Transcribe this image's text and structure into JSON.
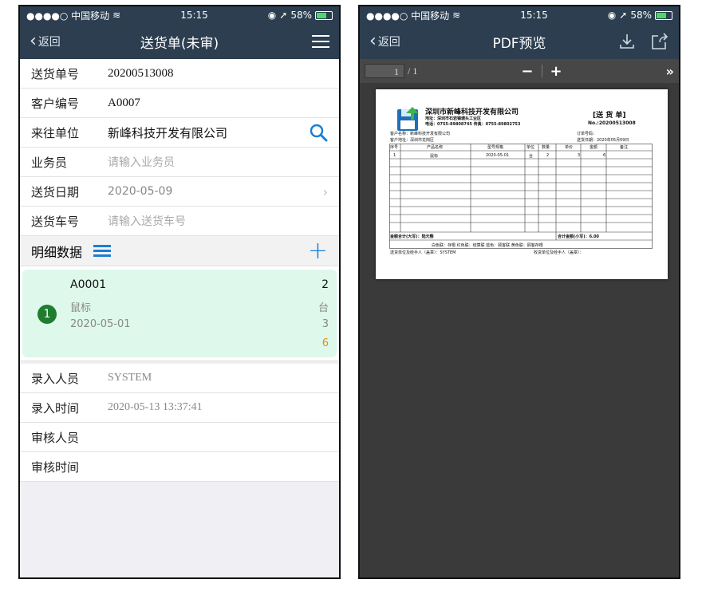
{
  "status": {
    "carrier": "●●●●○ 中国移动",
    "time": "15:15",
    "battery": "58%",
    "battery_fraction": 0.58
  },
  "left": {
    "nav": {
      "back": "返回",
      "title": "送货单(未审)"
    },
    "fields": [
      {
        "label": "送货单号",
        "value": "20200513008"
      },
      {
        "label": "客户编号",
        "value": "A0007"
      },
      {
        "label": "来往单位",
        "value": "新峰科技开发有限公司"
      },
      {
        "label": "业务员",
        "placeholder": "请输入业务员"
      },
      {
        "label": "送货日期",
        "value": "2020-05-09"
      },
      {
        "label": "送货车号",
        "placeholder": "请输入送货车号"
      }
    ],
    "section_title": "明细数据",
    "item": {
      "index": "1",
      "code": "A0001",
      "name": "鼠标",
      "date": "2020-05-01",
      "r1": "2",
      "r2": "台",
      "r3": "3",
      "r4": "6"
    },
    "meta": [
      {
        "label": "录入人员",
        "value": "SYSTEM"
      },
      {
        "label": "录入时间",
        "value": "2020-05-13 13:37:41"
      },
      {
        "label": "审核人员",
        "value": ""
      },
      {
        "label": "审核时间",
        "value": ""
      }
    ]
  },
  "right": {
    "nav": {
      "back": "返回",
      "title": "PDF预览"
    },
    "page_indicator": {
      "current": "1",
      "total": "/ 1"
    },
    "zoom_out": "−",
    "zoom_in": "+",
    "more": "»",
    "pdf": {
      "company": "深圳市新峰科技开发有限公司",
      "address": "地址：深圳市石岩镇塘头工业区",
      "phone": "电话：0755-89808745  传真：0755-89802753",
      "doc_title": "[送 货 单]",
      "doc_no": "No.:20200513008",
      "customer_name": "客户名称：新峰科技开发有限公司",
      "customer_addr": "客户地址：深圳市龙岗区",
      "order_no": "订单号码：",
      "ship_date": "送货日期：2020年05月09日",
      "headers": [
        "序号",
        "产品名称",
        "型号规格",
        "单位",
        "数量",
        "单价",
        "金额",
        "备注"
      ],
      "row": [
        "1",
        "鼠标",
        "2020-05-01",
        "台",
        "2",
        "3",
        "6",
        ""
      ],
      "total_upper": "金额合计(大写)：陆元整",
      "total_lower": "合计金额(小写)：6.00",
      "copies": "白色联：存根     红色联：结算联     蓝色：顾客联     黄色联：顾客存根",
      "sender": "送货单位及经手人（盖章）：SYSTEM",
      "receiver": "收货单位及经手人（盖章）："
    }
  },
  "colors": {
    "nav": "#2c3e50",
    "accent": "#1a7fd4",
    "card": "#def8ec",
    "badge": "#1e7d2e",
    "orange": "#f08c00"
  }
}
